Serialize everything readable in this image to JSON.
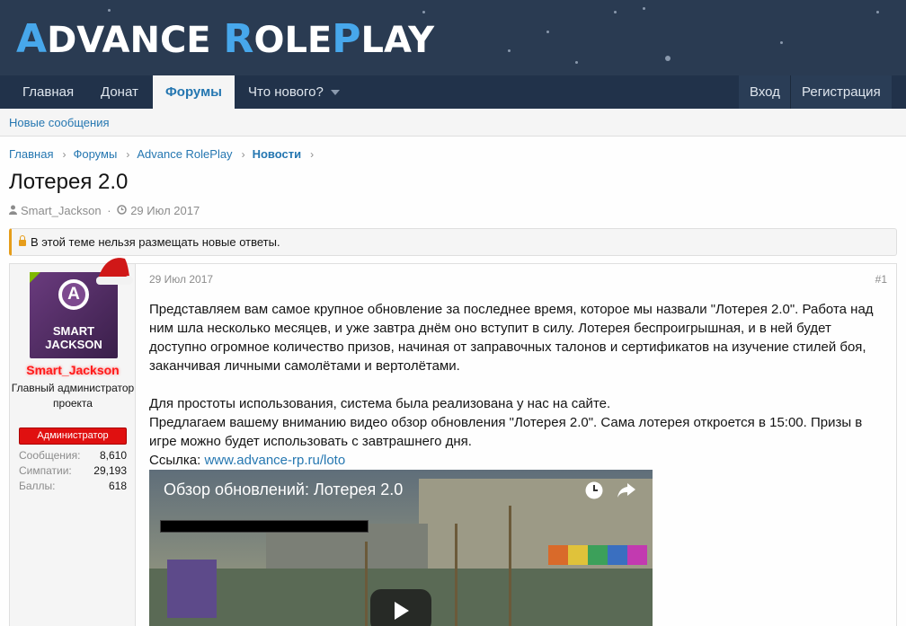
{
  "header": {
    "logo_first_letter": "A",
    "logo_word1": "DVANCE ",
    "logo_second_letter": "R",
    "logo_word2": "OLE",
    "logo_third_letter": "P",
    "logo_word3": "LAY"
  },
  "nav": {
    "items": [
      {
        "label": "Главная"
      },
      {
        "label": "Донат"
      },
      {
        "label": "Форумы"
      },
      {
        "label": "Что нового?"
      }
    ],
    "login": "Вход",
    "register": "Регистрация"
  },
  "subnav": {
    "new_posts": "Новые сообщения"
  },
  "breadcrumb": [
    "Главная",
    "Форумы",
    "Advance RolePlay",
    "Новости"
  ],
  "thread": {
    "title": "Лотерея 2.0",
    "author": "Smart_Jackson",
    "date": "29 Июл 2017",
    "notice": "В этой теме нельзя размещать новые ответы."
  },
  "post": {
    "avatar_letter": "A",
    "avatar_line1": "SMART",
    "avatar_line2": "JACKSON",
    "username": "Smart_Jackson",
    "user_title": "Главный администратор проекта",
    "user_banner": "Администратор",
    "stats": [
      {
        "label": "Сообщения:",
        "value": "8,610"
      },
      {
        "label": "Симпатии:",
        "value": "29,193"
      },
      {
        "label": "Баллы:",
        "value": "618"
      }
    ],
    "date": "29 Июл 2017",
    "number": "#1",
    "paragraph1": "Представляем вам самое крупное обновление за последнее время, которое мы назвали \"Лотерея 2.0\". Работа над ним шла несколько месяцев, и уже завтра днём оно вступит в силу. Лотерея беспроигрышная, и в ней будет доступно огромное количество призов, начиная от заправочных талонов и сертификатов на изучение стилей боя, заканчивая личными самолётами и вертолётами.",
    "paragraph2": "Для простоты использования, система была реализована у нас на сайте.",
    "paragraph3": "Предлагаем вашему вниманию видео обзор обновления \"Лотерея 2.0\". Сама лотерея откроется в 15:00. Призы в игре можно будет использовать с завтрашнего дня.",
    "link_label": "Ссылка:",
    "link_text": "www.advance-rp.ru/loto",
    "video_title": "Обзор обновлений: Лотерея 2.0"
  },
  "colors": {
    "header_bg": "#2a3b52",
    "nav_bg": "#21324a",
    "link": "#2577b1",
    "logo_accent": "#47a7eb",
    "notice_border": "#e69d1a",
    "username": "#ff1a1a",
    "banner": "#e01010"
  }
}
